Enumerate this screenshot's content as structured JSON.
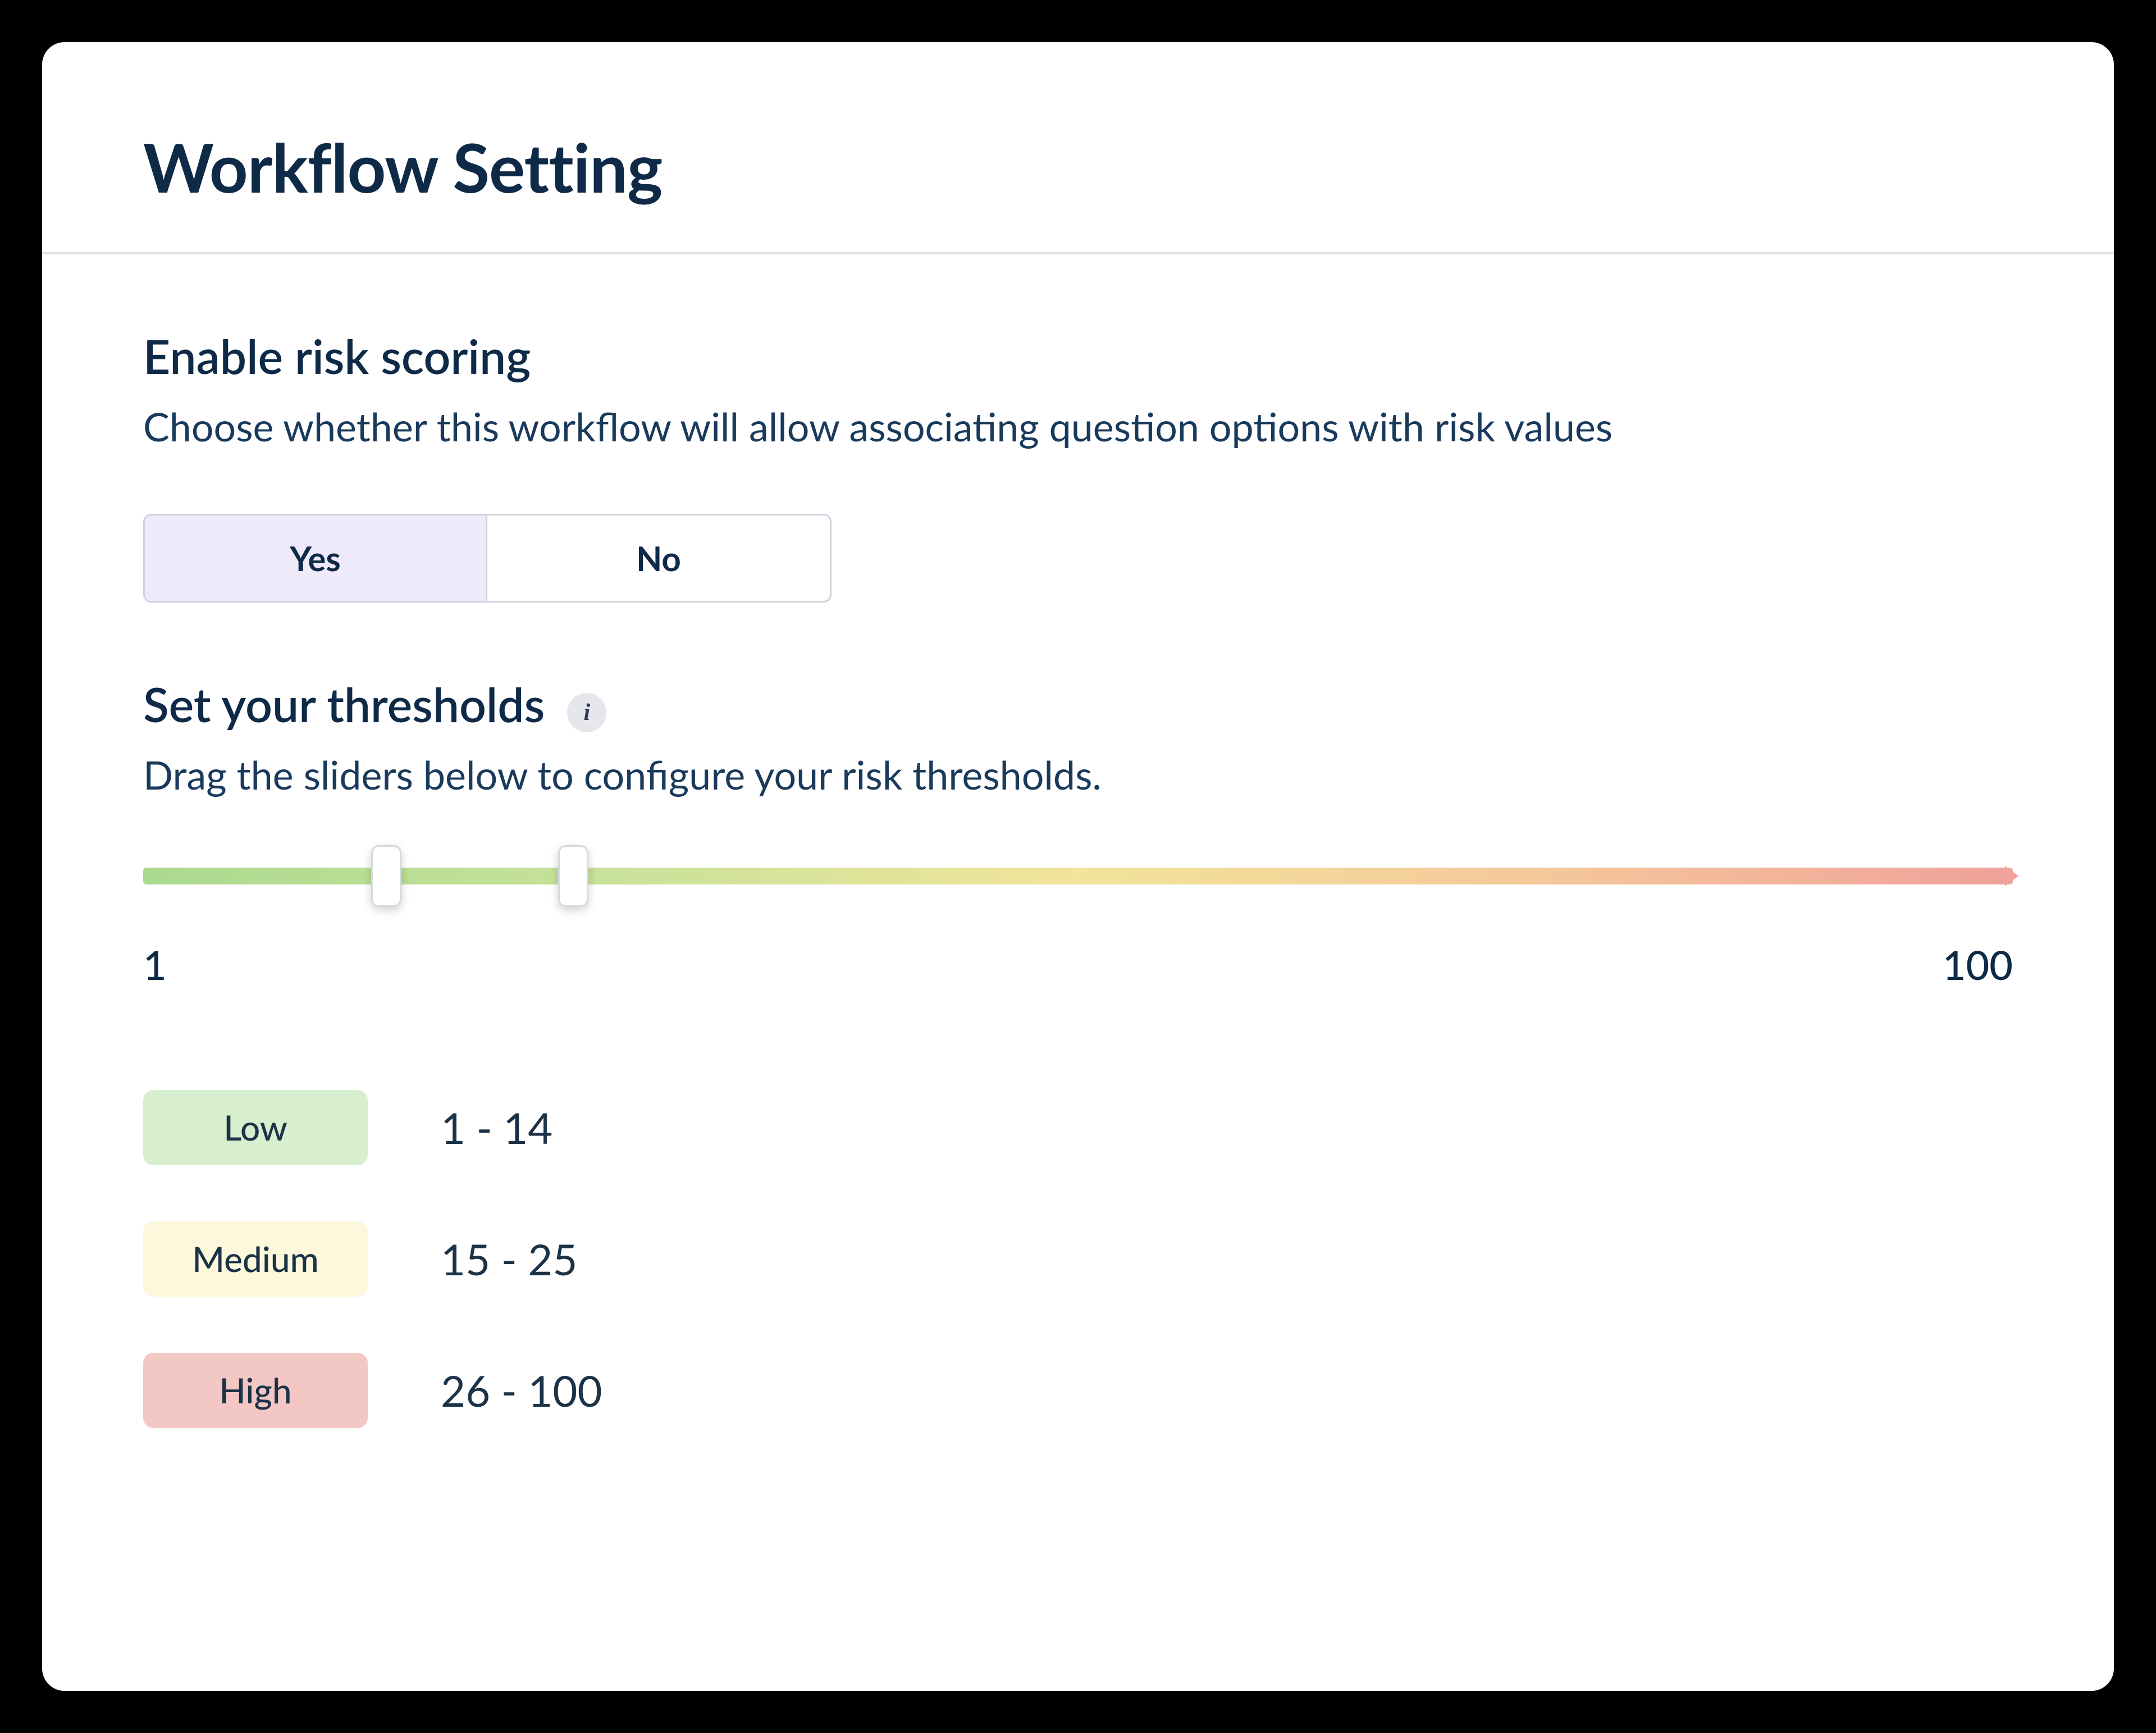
{
  "header": {
    "title": "Workflow Setting"
  },
  "risk_scoring": {
    "title": "Enable risk scoring",
    "subtitle": "Choose whether this workflow will allow associating question options with risk values",
    "options": {
      "yes": "Yes",
      "no": "No"
    },
    "selected": "yes"
  },
  "thresholds": {
    "title": "Set your thresholds",
    "subtitle": "Drag the sliders below to configure your risk thresholds.",
    "info_glyph": "i",
    "slider": {
      "min": 1,
      "max": 100,
      "min_label": "1",
      "max_label": "100",
      "handle1_pct": 13,
      "handle2_pct": 23
    },
    "levels": {
      "low": {
        "label": "Low",
        "range_text": "1 - 14",
        "min": 1,
        "max": 14
      },
      "medium": {
        "label": "Medium",
        "range_text": "15 - 25",
        "min": 15,
        "max": 25
      },
      "high": {
        "label": "High",
        "range_text": "26 - 100",
        "min": 26,
        "max": 100
      }
    }
  },
  "colors": {
    "text_primary": "#0e2a47",
    "low": "#d8efcf",
    "medium": "#fdf8dc",
    "high": "#f3c7c4",
    "toggle_selected_bg": "#eeeaf9"
  }
}
